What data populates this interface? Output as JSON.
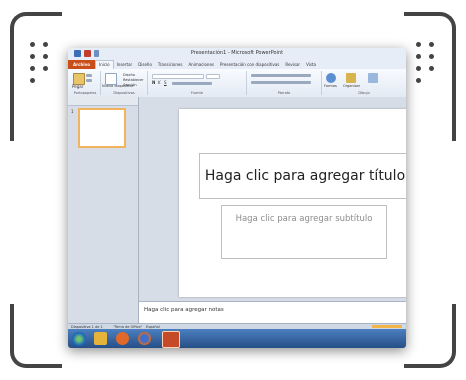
{
  "window": {
    "title": "Presentación1 - Microsoft PowerPoint"
  },
  "ribbon": {
    "tabs": [
      "Archivo",
      "Inicio",
      "Insertar",
      "Diseño",
      "Transiciones",
      "Animaciones",
      "Presentación con diapositivas",
      "Revisar",
      "Vista"
    ],
    "active_tab": "Inicio",
    "groups": [
      "Portapapeles",
      "Diapositivas",
      "Fuente",
      "Párrafo",
      "Dibujo"
    ],
    "buttons": {
      "paste": "Pegar",
      "new_slide": "Nueva diapositiva",
      "design": "Diseño",
      "reset": "Restablecer",
      "section": "Sección",
      "shapes": "Formas",
      "arrange": "Organizar"
    }
  },
  "slide": {
    "number": "1",
    "title_placeholder": "Haga clic para agregar título",
    "subtitle_placeholder": "Haga clic para agregar subtítulo"
  },
  "notes": {
    "placeholder": "Haga clic para agregar notas"
  },
  "statusbar": {
    "slide_info": "Diapositiva 1 de 1",
    "theme": "\"Tema de Office\"",
    "language": "Español"
  },
  "colors": {
    "file_tab": "#c94f1a",
    "taskbar": "#274f86",
    "selection": "#f2b35d"
  }
}
